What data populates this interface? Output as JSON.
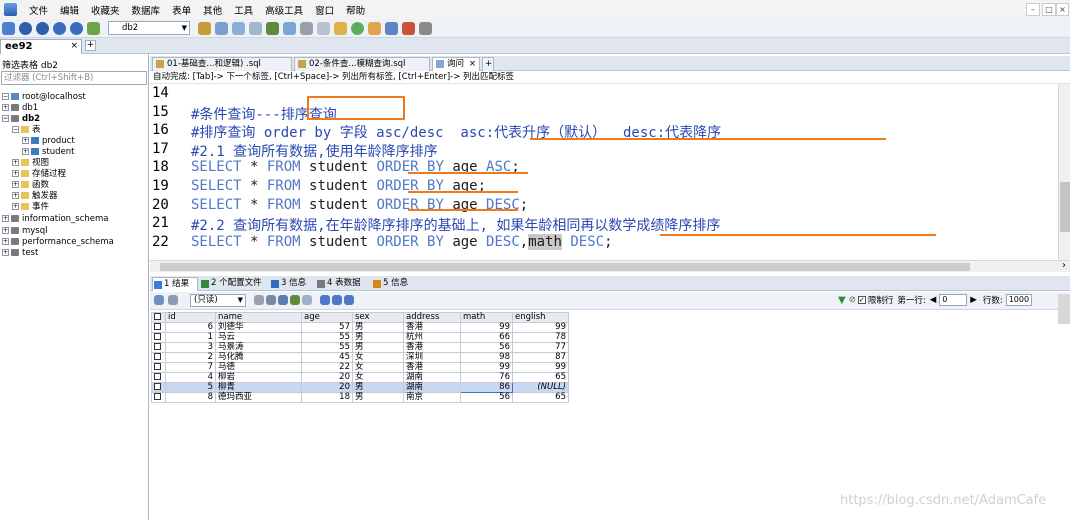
{
  "menu": [
    "文件",
    "编辑",
    "收藏夹",
    "数据库",
    "表单",
    "其他",
    "工具",
    "高级工具",
    "窗口",
    "帮助"
  ],
  "window_controls": [
    "–",
    "□",
    "×"
  ],
  "toolbar": {
    "db_select": "db2"
  },
  "connection_tab": {
    "label": "ee92",
    "close": "×",
    "add": "+"
  },
  "left": {
    "filter_label": "筛选表格 db2",
    "filter_placeholder": "过滤器 (Ctrl+Shift+B)",
    "tree": {
      "root": "root@localhost",
      "db1": "db1",
      "db2": "db2",
      "tables": "表",
      "product": "product",
      "student": "student",
      "views": "视图",
      "procedures": "存储过程",
      "functions": "函数",
      "triggers": "触发器",
      "events": "事件",
      "information_schema": "information_schema",
      "mysql": "mysql",
      "performance_schema": "performance_schema",
      "test": "test"
    }
  },
  "editor_tabs": [
    {
      "label": "01-基础查...和逻辑) .sql"
    },
    {
      "label": "02-条件查...模糊查询.sql"
    },
    {
      "label": "询问",
      "close": "×"
    }
  ],
  "editor_tab_add": "+",
  "info_line": "自动完成: [Tab]-> 下一个标签, [Ctrl+Space]-> 列出所有标签, [Ctrl+Enter]-> 列出匹配标签",
  "editor": {
    "lines": [
      {
        "no": "14",
        "parts": []
      },
      {
        "no": "15",
        "parts": [
          {
            "t": "#条件查询---排序查询",
            "c": "cm"
          }
        ]
      },
      {
        "no": "16",
        "parts": [
          {
            "t": "#排序查询 order by 字段 asc/desc  asc:代表升序（默认）  desc:代表降序",
            "c": "cm"
          }
        ]
      },
      {
        "no": "17",
        "parts": [
          {
            "t": "#2.1 查询所有数据,使用年龄降序排序",
            "c": "cm"
          }
        ]
      },
      {
        "no": "18",
        "parts": [
          {
            "t": "SELECT",
            "c": "kw"
          },
          {
            "t": " * ",
            "c": "tx"
          },
          {
            "t": "FROM",
            "c": "kw"
          },
          {
            "t": " student ",
            "c": "tx"
          },
          {
            "t": "ORDER BY",
            "c": "kw"
          },
          {
            "t": " age ",
            "c": "tx"
          },
          {
            "t": "ASC",
            "c": "kw"
          },
          {
            "t": ";",
            "c": "tx"
          }
        ]
      },
      {
        "no": "19",
        "parts": [
          {
            "t": "SELECT",
            "c": "kw"
          },
          {
            "t": " * ",
            "c": "tx"
          },
          {
            "t": "FROM",
            "c": "kw"
          },
          {
            "t": " student ",
            "c": "tx"
          },
          {
            "t": "ORDER BY",
            "c": "kw"
          },
          {
            "t": " age;",
            "c": "tx"
          }
        ]
      },
      {
        "no": "20",
        "parts": [
          {
            "t": "SELECT",
            "c": "kw"
          },
          {
            "t": " * ",
            "c": "tx"
          },
          {
            "t": "FROM",
            "c": "kw"
          },
          {
            "t": " student ",
            "c": "tx"
          },
          {
            "t": "ORDER BY",
            "c": "kw"
          },
          {
            "t": " age ",
            "c": "tx"
          },
          {
            "t": "DESC",
            "c": "kw"
          },
          {
            "t": ";",
            "c": "tx"
          }
        ]
      },
      {
        "no": "21",
        "parts": [
          {
            "t": "#2.2 查询所有数据,在年龄降序排序的基础上, 如果年龄相同再以数学成绩降序排序",
            "c": "cm"
          }
        ]
      },
      {
        "no": "22",
        "parts": [
          {
            "t": "SELECT",
            "c": "kw"
          },
          {
            "t": " * ",
            "c": "tx"
          },
          {
            "t": "FROM",
            "c": "kw"
          },
          {
            "t": " student ",
            "c": "tx"
          },
          {
            "t": "ORDER BY",
            "c": "kw"
          },
          {
            "t": " age ",
            "c": "tx"
          },
          {
            "t": "DESC",
            "c": "kw"
          },
          {
            "t": ",",
            "c": "tx"
          },
          {
            "t": "math",
            "c": "tx hl"
          },
          {
            "t": " ",
            "c": "tx"
          },
          {
            "t": "DESC",
            "c": "kw"
          },
          {
            "t": ";",
            "c": "tx"
          }
        ]
      }
    ]
  },
  "result_tabs": [
    {
      "label": "1 结果",
      "color": "#3a7bd5"
    },
    {
      "label": "2 个配置文件",
      "color": "#2e8b3e"
    },
    {
      "label": "3 信息",
      "color": "#2a6fc0"
    },
    {
      "label": "4 表数据",
      "color": "#7a7a7a"
    },
    {
      "label": "5 信息",
      "color": "#d08a1a"
    }
  ],
  "result_toolbar": {
    "mode": "(只读)",
    "limit_label": "限制行",
    "first_row_label": "第一行:",
    "first_row_value": "0",
    "rows_label": "行数:",
    "rows_value": "1000"
  },
  "grid": {
    "columns": [
      "id",
      "name",
      "age",
      "sex",
      "address",
      "math",
      "english"
    ],
    "rows": [
      [
        "6",
        "刘德华",
        "57",
        "男",
        "香港",
        "99",
        "99"
      ],
      [
        "1",
        "马云",
        "55",
        "男",
        "杭州",
        "66",
        "78"
      ],
      [
        "3",
        "马景涛",
        "55",
        "男",
        "香港",
        "56",
        "77"
      ],
      [
        "2",
        "马化腾",
        "45",
        "女",
        "深圳",
        "98",
        "87"
      ],
      [
        "7",
        "马德",
        "22",
        "女",
        "香港",
        "99",
        "99"
      ],
      [
        "4",
        "柳岩",
        "20",
        "女",
        "湖南",
        "76",
        "65"
      ],
      [
        "5",
        "柳青",
        "20",
        "男",
        "湖南",
        "86",
        "(NULL)"
      ],
      [
        "8",
        "德玛西亚",
        "18",
        "男",
        "南京",
        "56",
        "65"
      ]
    ],
    "selected_row": 6
  },
  "watermark": "https://blog.csdn.net/AdamCafe"
}
